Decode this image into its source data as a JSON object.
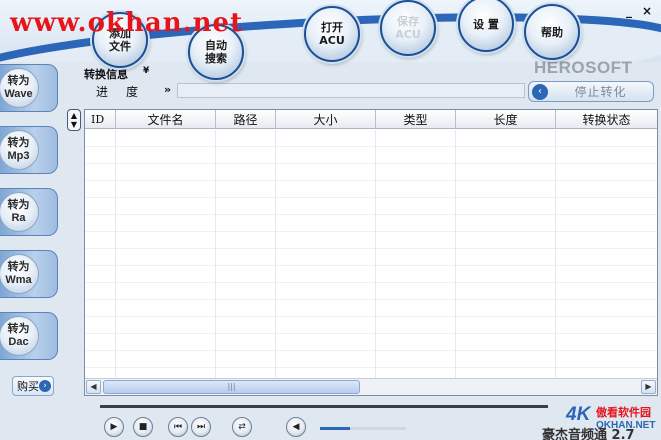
{
  "watermark": "www.okhan.net",
  "window": {
    "minimize": "_",
    "close": "×"
  },
  "brand": "HEROSOFT",
  "toolbar": [
    {
      "label": "添加\n文件",
      "enabled": true
    },
    {
      "label": "自动\n搜索",
      "enabled": true
    },
    {
      "label": "打开\nACU",
      "enabled": true
    },
    {
      "label": "保存\nACU",
      "enabled": false
    },
    {
      "label": "设 置",
      "enabled": true
    },
    {
      "label": "帮助",
      "enabled": true
    }
  ],
  "sidebar": [
    {
      "label": "转为\nWave"
    },
    {
      "label": "转为\nMp3"
    },
    {
      "label": "转为\nRa"
    },
    {
      "label": "转为\nWma"
    },
    {
      "label": "转为\nDac"
    }
  ],
  "buy_label": "购买",
  "info": {
    "label": "转换信息",
    "expand": "¥"
  },
  "progress": {
    "label": "进度",
    "arrows": "»",
    "value": 0
  },
  "stop_label": "停止转化",
  "table": {
    "columns": [
      "ID",
      "文件名",
      "路径",
      "大小",
      "类型",
      "长度",
      "转换状态"
    ],
    "rows": []
  },
  "player": {
    "title_partial": "豪杰音频通 2.7"
  },
  "logo": {
    "mark": "4K",
    "site": "傲看软件园",
    "url": "OKHAN.NET"
  },
  "colors": {
    "accent": "#2b67b5",
    "watermark": "#e8141c"
  }
}
